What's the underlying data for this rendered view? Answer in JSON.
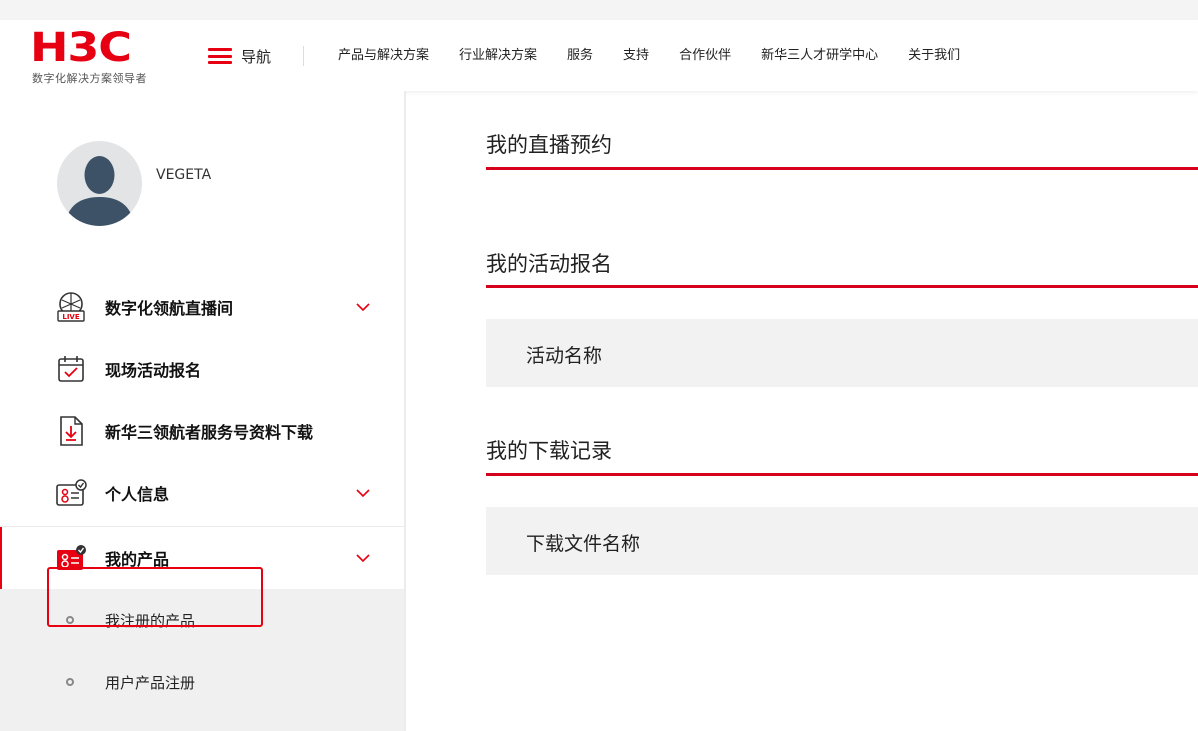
{
  "brand": {
    "logo_text": "H3C",
    "tagline": "数字化解决方案领导者",
    "accent_color": "#e60012"
  },
  "header": {
    "nav_toggle_label": "导航",
    "menu": [
      "产品与解决方案",
      "行业解决方案",
      "服务",
      "支持",
      "合作伙伴",
      "新华三人才研学中心",
      "关于我们"
    ]
  },
  "user": {
    "name": "VEGETA"
  },
  "sidebar": {
    "items": [
      {
        "label": "数字化领航直播间",
        "icon": "live-icon",
        "expandable": true
      },
      {
        "label": "现场活动报名",
        "icon": "calendar-check-icon",
        "expandable": false
      },
      {
        "label": "新华三领航者服务号资料下载",
        "icon": "download-document-icon",
        "expandable": false
      },
      {
        "label": "个人信息",
        "icon": "id-card-icon",
        "expandable": true
      },
      {
        "label": "我的产品",
        "icon": "product-card-icon",
        "expandable": true,
        "active": true
      }
    ],
    "subitems": [
      {
        "label": "我注册的产品"
      },
      {
        "label": "用户产品注册",
        "highlighted": true
      }
    ]
  },
  "main": {
    "sections": [
      {
        "title": "我的直播预约"
      },
      {
        "title": "我的活动报名",
        "column_header": "活动名称"
      },
      {
        "title": "我的下载记录",
        "column_header": "下载文件名称"
      }
    ]
  }
}
